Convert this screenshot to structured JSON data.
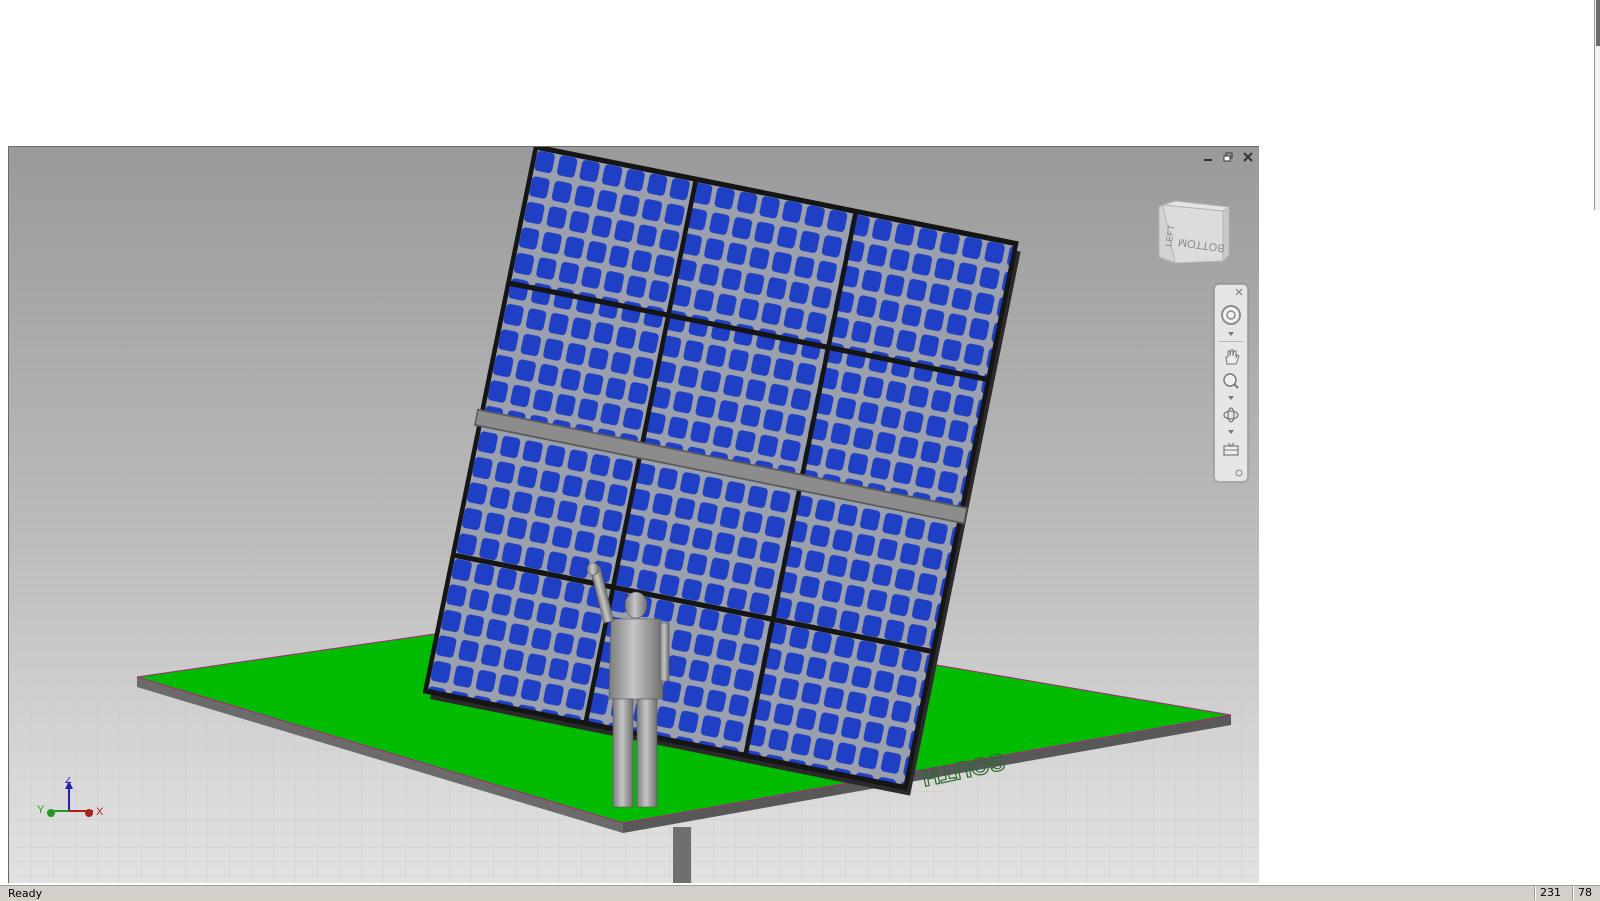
{
  "app": {
    "window_controls": {
      "minimize_icon": "minimize-icon",
      "restore_icon": "restore-icon",
      "close_icon": "close-icon"
    }
  },
  "viewport": {
    "background_top": "#9a9a9a",
    "background_bottom": "#e2e2e2",
    "model": {
      "panel_color": "#1e3ec8",
      "ground_color": "#00b800",
      "ground_label": "SOUTH"
    }
  },
  "viewcube": {
    "face_left": "LEFT",
    "face_bottom": "BOTTOM"
  },
  "navbar": {
    "items": [
      {
        "icon": "steering-wheel-icon"
      },
      {
        "icon": "pan-icon"
      },
      {
        "icon": "zoom-icon"
      },
      {
        "icon": "orbit-icon"
      },
      {
        "icon": "look-at-icon"
      }
    ]
  },
  "triad": {
    "z": "Z",
    "y": "Y",
    "x": "X"
  },
  "status": {
    "text": "Ready",
    "x": "231",
    "y": "78"
  }
}
